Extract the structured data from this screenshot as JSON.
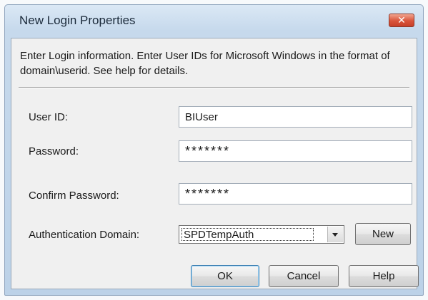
{
  "window": {
    "title": "New Login Properties",
    "close_symbol": "✕"
  },
  "instructions": "Enter Login information. Enter User IDs for Microsoft Windows in the format of domain\\userid. See help for details.",
  "fields": {
    "user_id": {
      "label": "User ID:",
      "value": "BIUser"
    },
    "password": {
      "label": "Password:",
      "value": "*******"
    },
    "confirm_password": {
      "label": "Confirm Password:",
      "value": "*******"
    },
    "auth_domain": {
      "label": "Authentication Domain:",
      "value": "SPDTempAuth"
    }
  },
  "buttons": {
    "new": "New",
    "ok": "OK",
    "cancel": "Cancel",
    "help": "Help"
  },
  "icons": {
    "close": "close-icon",
    "dropdown": "chevron-down-icon"
  }
}
